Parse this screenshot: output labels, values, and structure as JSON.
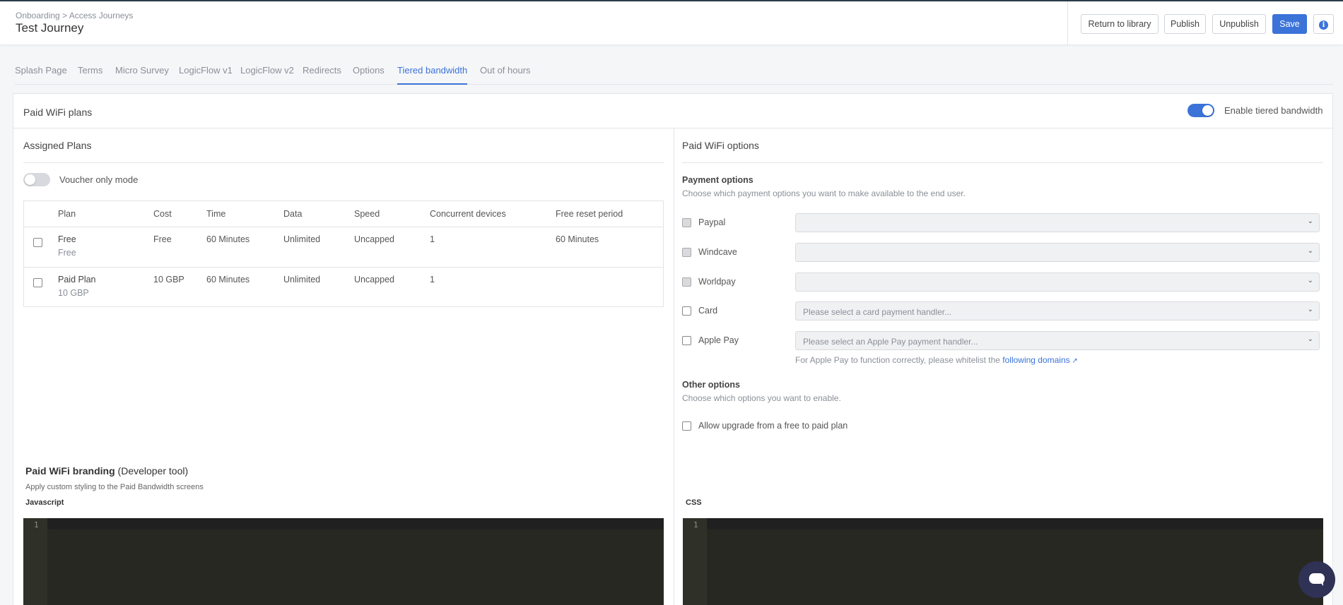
{
  "header": {
    "breadcrumb": "Onboarding > Access Journeys",
    "title": "Test Journey",
    "actions": {
      "return_label": "Return to library",
      "publish_label": "Publish",
      "unpublish_label": "Unpublish",
      "save_label": "Save",
      "info_glyph": "i"
    }
  },
  "tabs": [
    "Splash Page",
    "Terms",
    "Micro Survey",
    "LogicFlow v1",
    "LogicFlow v2",
    "Redirects",
    "Options",
    "Tiered bandwidth",
    "Out of hours"
  ],
  "active_tab": "Tiered bandwidth",
  "card": {
    "title": "Paid WiFi plans",
    "enable_label": "Enable tiered bandwidth",
    "enable_on": true
  },
  "assigned": {
    "title": "Assigned Plans",
    "voucher_label": "Voucher only mode",
    "voucher_on": false,
    "columns": [
      "Plan",
      "Cost",
      "Time",
      "Data",
      "Speed",
      "Concurrent devices",
      "Free reset period"
    ],
    "rows": [
      {
        "plan": "Free",
        "plan_sub": "Free",
        "cost": "Free",
        "time": "60 Minutes",
        "data": "Unlimited",
        "speed": "Uncapped",
        "devices": "1",
        "reset": "60 Minutes"
      },
      {
        "plan": "Paid Plan",
        "plan_sub": "10 GBP",
        "cost": "10 GBP",
        "time": "60 Minutes",
        "data": "Unlimited",
        "speed": "Uncapped",
        "devices": "1",
        "reset": ""
      }
    ]
  },
  "paid_options": {
    "title": "Paid WiFi options",
    "payment_heading": "Payment options",
    "payment_sub": "Choose which payment options you want to make available to the end user.",
    "methods": [
      {
        "label": "Paypal",
        "placeholder": "",
        "disabled": true
      },
      {
        "label": "Windcave",
        "placeholder": "",
        "disabled": true
      },
      {
        "label": "Worldpay",
        "placeholder": "",
        "disabled": true
      },
      {
        "label": "Card",
        "placeholder": "Please select a card payment handler...",
        "disabled": false
      },
      {
        "label": "Apple Pay",
        "placeholder": "Please select an Apple Pay payment handler...",
        "disabled": false
      }
    ],
    "apple_note": "For Apple Pay to function correctly, please whitelist the",
    "apple_link": "following domains",
    "other_heading": "Other options",
    "other_sub": "Choose which options you want to enable.",
    "upgrade_label": "Allow upgrade from a free to paid plan"
  },
  "branding": {
    "title_bold": "Paid WiFi branding",
    "title_rest": "(Developer tool)",
    "subtitle": "Apply custom styling to the Paid Bandwidth screens",
    "js_label": "Javascript",
    "css_label": "CSS",
    "line_number": "1"
  },
  "colors": {
    "accent": "#3b73d9",
    "editor_bg": "#272822",
    "chat_bg": "#2f3155"
  },
  "icons": [
    "info-icon",
    "chevron-down-icon",
    "external-link-icon",
    "chat-icon"
  ]
}
